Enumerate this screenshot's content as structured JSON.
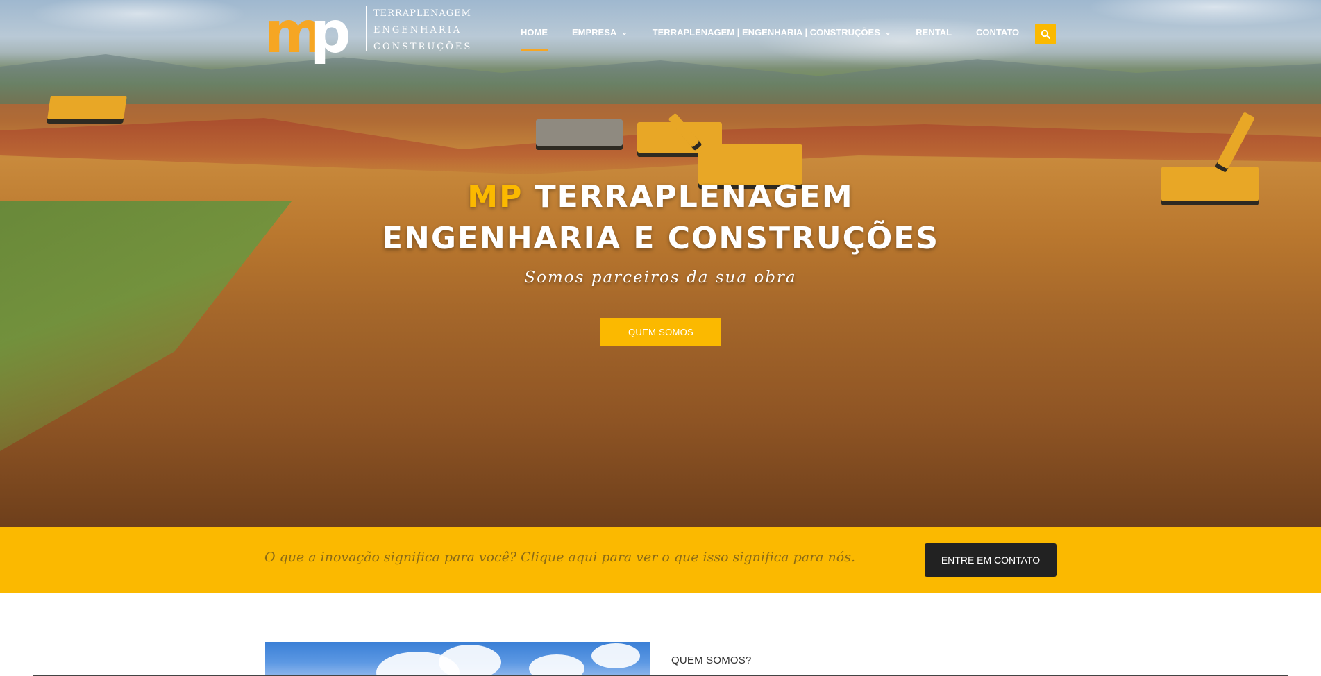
{
  "header": {
    "logo": {
      "mark_left": "m",
      "mark_right": "p",
      "line1": "TERRAPLENAGEM",
      "line2": "ENGENHARIA",
      "line3": "CONSTRUÇÕES"
    },
    "nav": [
      {
        "label": "HOME",
        "active": true
      },
      {
        "label": "EMPRESA",
        "has_dropdown": true
      },
      {
        "label": "TERRAPLENAGEM | ENGENHARIA | CONSTRUÇÕES",
        "has_dropdown": true
      },
      {
        "label": "RENTAL"
      },
      {
        "label": "CONTATO"
      }
    ],
    "search_icon": "search-icon"
  },
  "hero": {
    "title_accent": "MP",
    "title_rest": "TERRAPLENAGEM",
    "title_line2": "ENGENHARIA E CONSTRUÇÕES",
    "subtitle": "Somos parceiros da sua obra",
    "button_label": "QUEM SOMOS"
  },
  "cta": {
    "text": "O que a inovação significa para você? Clique aqui para ver o que isso significa para nós.",
    "button_label": "ENTRE EM CONTATO"
  },
  "about": {
    "label": "QUEM SOMOS?"
  },
  "colors": {
    "accent": "#fbb900",
    "logo_orange": "#f6a623",
    "dark_button": "#222222"
  }
}
